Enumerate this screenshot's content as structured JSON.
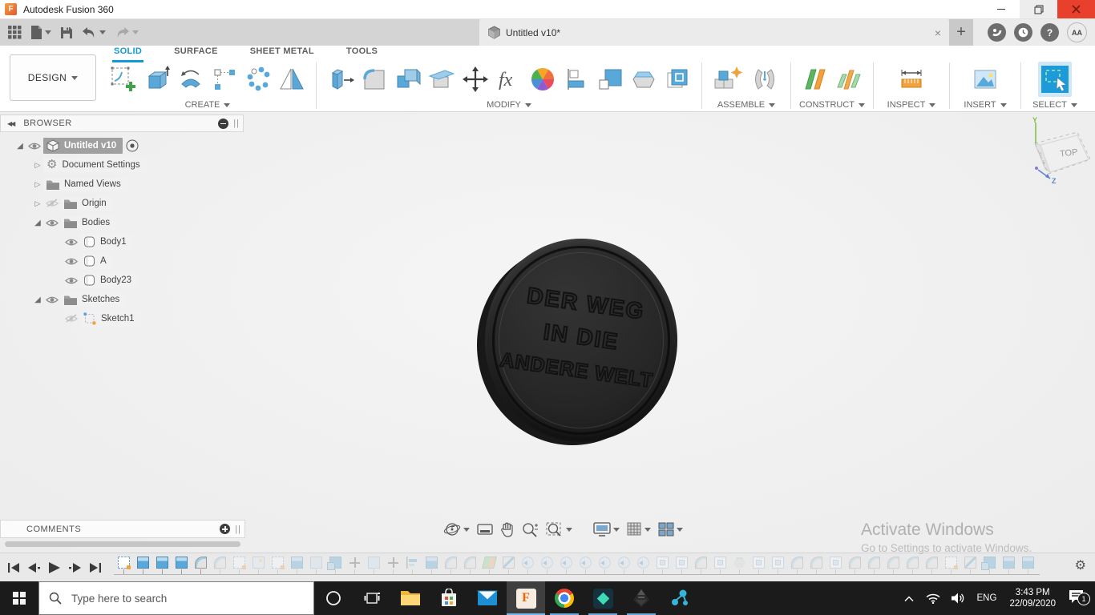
{
  "window": {
    "title": "Autodesk Fusion 360"
  },
  "app_bar": {
    "document_tab": {
      "title": "Untitled v10*"
    },
    "user_initials": "AA",
    "quick_access": [
      "app-grid",
      "file-new",
      "save",
      "undo",
      "redo"
    ],
    "right_icons": [
      "job-status",
      "notifications-clock",
      "help",
      "profile-avatar"
    ]
  },
  "ribbon": {
    "workspace": "DESIGN",
    "tabs": [
      {
        "label": "SOLID",
        "active": true
      },
      {
        "label": "SURFACE",
        "active": false
      },
      {
        "label": "SHEET METAL",
        "active": false
      },
      {
        "label": "TOOLS",
        "active": false
      }
    ],
    "groups": [
      {
        "label": "CREATE",
        "tools": [
          "create-sketch",
          "extrude",
          "revolve",
          "rectangular-pattern",
          "circular-pattern",
          "mirror"
        ]
      },
      {
        "label": "MODIFY",
        "tools": [
          "press-pull",
          "fillet",
          "combine",
          "split-body",
          "move-copy",
          "change-parameters",
          "appearance",
          "align",
          "scale",
          "draft",
          "offset-face"
        ]
      },
      {
        "label": "ASSEMBLE",
        "tools": [
          "new-component",
          "joint"
        ]
      },
      {
        "label": "CONSTRUCT",
        "tools": [
          "offset-plane",
          "midplane"
        ]
      },
      {
        "label": "INSPECT",
        "tools": [
          "measure"
        ]
      },
      {
        "label": "INSERT",
        "tools": [
          "insert-image"
        ]
      },
      {
        "label": "SELECT",
        "tools": [
          "select"
        ]
      }
    ]
  },
  "browser": {
    "title": "BROWSER",
    "rows": [
      {
        "label": "Untitled v10",
        "selected": true,
        "icon": "component",
        "eye": "on",
        "expander": "expanded"
      },
      {
        "label": "Document Settings",
        "icon": "gear",
        "expander": "collapsed"
      },
      {
        "label": "Named Views",
        "icon": "folder",
        "expander": "collapsed"
      },
      {
        "label": "Origin",
        "icon": "folder",
        "eye": "off",
        "expander": "collapsed"
      },
      {
        "label": "Bodies",
        "icon": "folder",
        "eye": "on",
        "expander": "expanded"
      },
      {
        "label": "Body1",
        "icon": "body",
        "eye": "on"
      },
      {
        "label": "A",
        "icon": "body",
        "eye": "on"
      },
      {
        "label": "Body23",
        "icon": "body",
        "eye": "on"
      },
      {
        "label": "Sketches",
        "icon": "folder",
        "eye": "on",
        "expander": "expanded"
      },
      {
        "label": "Sketch1",
        "icon": "sketch",
        "eye": "off"
      }
    ]
  },
  "viewcube": {
    "face": "TOP",
    "axis_y": "Y",
    "axis_z": "Z"
  },
  "model": {
    "engraving": [
      "DER WEG",
      "IN DIE",
      "ANDERE WELT"
    ]
  },
  "view_toolbar": {
    "tools": [
      "orbit",
      "look-at",
      "pan",
      "zoom",
      "zoom-window",
      "display-settings",
      "grid-settings",
      "viewports"
    ]
  },
  "comments": {
    "label": "COMMENTS"
  },
  "watermark": {
    "line1": "Activate Windows",
    "line2": "Go to Settings to activate Windows."
  },
  "timeline": {
    "features": [
      {
        "type": "sketch",
        "dim": false
      },
      {
        "type": "extrude",
        "dim": false
      },
      {
        "type": "extrude",
        "dim": false
      },
      {
        "type": "extrude",
        "dim": false
      },
      {
        "type": "fillet",
        "dim": false
      },
      {
        "type": "fillet",
        "dim": true
      },
      {
        "type": "sketch",
        "dim": true
      },
      {
        "type": "image",
        "dim": true
      },
      {
        "type": "sketch",
        "dim": true
      },
      {
        "type": "extrude",
        "dim": true
      },
      {
        "type": "box",
        "dim": true
      },
      {
        "type": "combine",
        "dim": true
      },
      {
        "type": "move",
        "dim": true
      },
      {
        "type": "box",
        "dim": true
      },
      {
        "type": "move",
        "dim": true
      },
      {
        "type": "align",
        "dim": true
      },
      {
        "type": "extrude",
        "dim": true
      },
      {
        "type": "fillet",
        "dim": true
      },
      {
        "type": "fillet",
        "dim": true
      },
      {
        "type": "plane",
        "dim": true
      },
      {
        "type": "split",
        "dim": true
      },
      {
        "type": "history",
        "dim": true
      },
      {
        "type": "history",
        "dim": true
      },
      {
        "type": "history",
        "dim": true
      },
      {
        "type": "history",
        "dim": true
      },
      {
        "type": "history",
        "dim": true
      },
      {
        "type": "history",
        "dim": true
      },
      {
        "type": "history",
        "dim": true
      },
      {
        "type": "shell",
        "dim": true
      },
      {
        "type": "shell",
        "dim": true
      },
      {
        "type": "fillet",
        "dim": true
      },
      {
        "type": "shell",
        "dim": true
      },
      {
        "type": "chamfer",
        "dim": true
      },
      {
        "type": "shell",
        "dim": true
      },
      {
        "type": "shell",
        "dim": true
      },
      {
        "type": "fillet",
        "dim": true
      },
      {
        "type": "fillet",
        "dim": true
      },
      {
        "type": "shell",
        "dim": true
      },
      {
        "type": "fillet",
        "dim": true
      },
      {
        "type": "fillet",
        "dim": true
      },
      {
        "type": "fillet",
        "dim": true
      },
      {
        "type": "fillet",
        "dim": true
      },
      {
        "type": "fillet",
        "dim": true
      },
      {
        "type": "sketch",
        "dim": true
      },
      {
        "type": "split",
        "dim": true
      },
      {
        "type": "combine",
        "dim": true
      },
      {
        "type": "extrude",
        "dim": true
      },
      {
        "type": "extrude",
        "dim": true
      }
    ]
  },
  "taskbar": {
    "search_placeholder": "Type here to search",
    "language": "ENG",
    "time": "3:43 PM",
    "date": "22/09/2020",
    "notification_count": "1",
    "apps": [
      "file-explorer",
      "microsoft-store",
      "mail",
      "fusion-360",
      "chrome",
      "filmora",
      "inkscape",
      "graph-tool"
    ]
  },
  "colors": {
    "accent_blue": "#0f9bd7",
    "close_red": "#e8402c",
    "taskbar": "#1b1b1b",
    "run_indicator": "#6aa9d8"
  }
}
